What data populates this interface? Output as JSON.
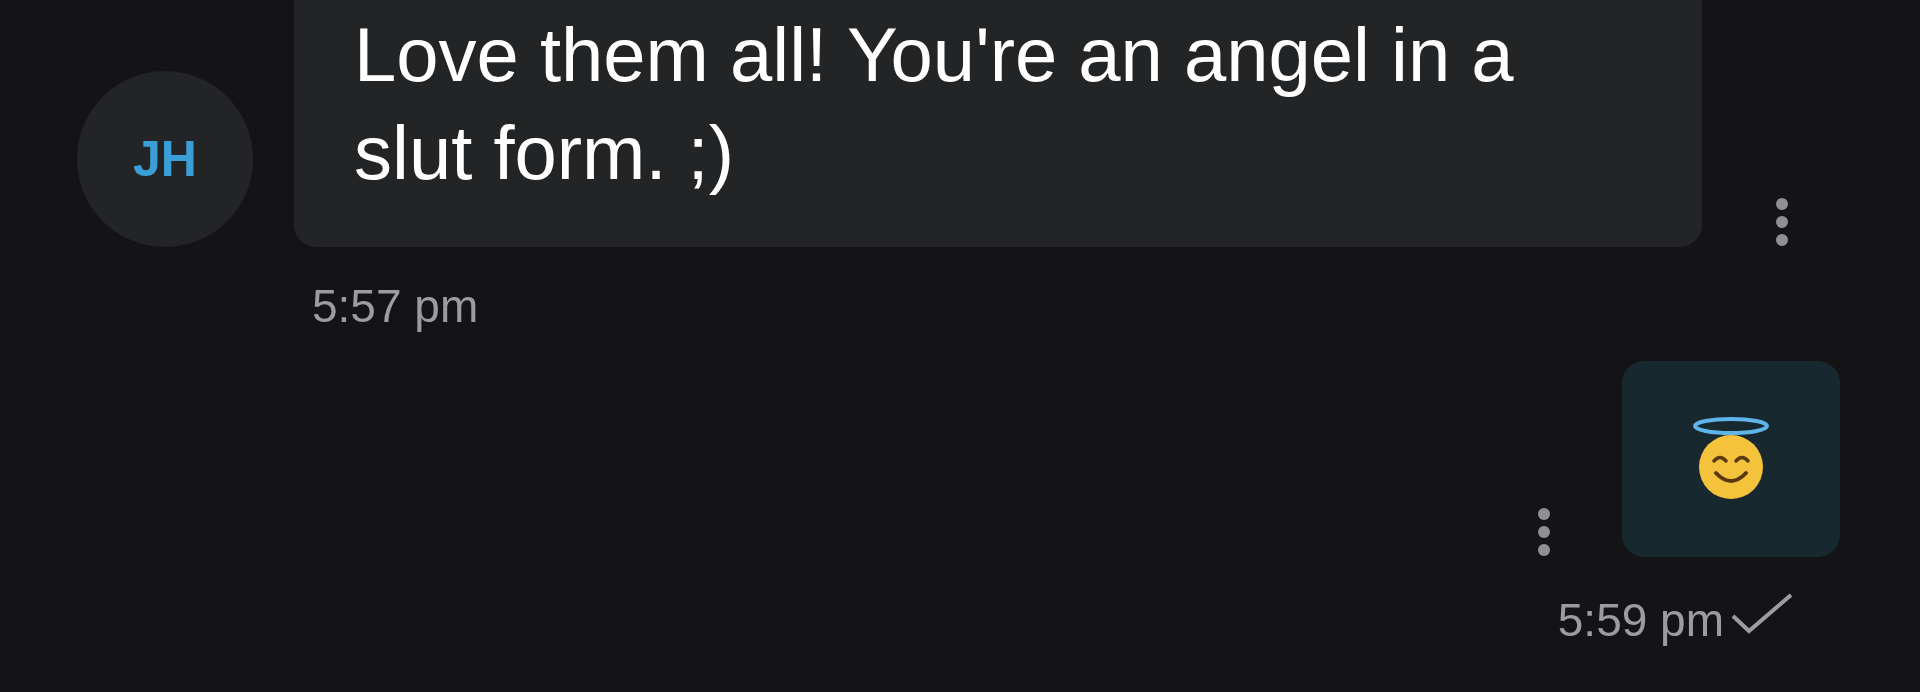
{
  "messages": [
    {
      "outgoing": false,
      "avatar": "JH",
      "kind": "text",
      "text": "Love them all! You're an angel in a slut form. ;)",
      "time": "5:57 pm"
    },
    {
      "outgoing": true,
      "kind": "emoji",
      "time": "5:59 pm",
      "sent": true
    }
  ]
}
